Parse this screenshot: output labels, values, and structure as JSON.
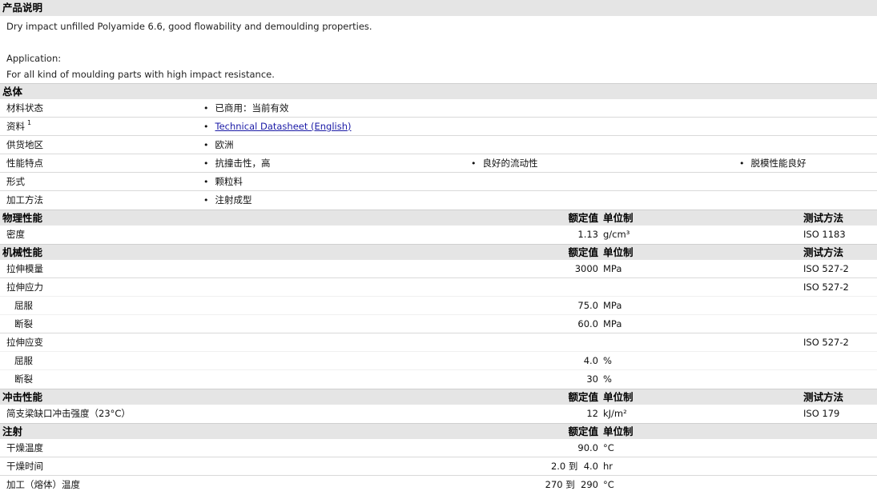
{
  "description": {
    "heading": "产品说明",
    "lines": [
      "Dry impact unfilled Polyamide 6.6, good flowability and demoulding properties.",
      "",
      "Application:",
      "For all kind of moulding parts with high impact resistance."
    ]
  },
  "general": {
    "heading": "总体",
    "rows": [
      {
        "label": "材料状态",
        "values": [
          "已商用：当前有效"
        ]
      },
      {
        "label": "资料",
        "sup": "1",
        "values": [
          "Technical Datasheet (English)"
        ]
      },
      {
        "label": "供货地区",
        "values": [
          "欧洲"
        ]
      },
      {
        "label": "性能特点",
        "values": [
          "抗撞击性，高",
          "良好的流动性",
          "脱模性能良好"
        ]
      },
      {
        "label": "形式",
        "values": [
          "颗粒料"
        ]
      },
      {
        "label": "加工方法",
        "values": [
          "注射成型"
        ]
      }
    ]
  },
  "col_headers": {
    "value": "额定值",
    "unit": "单位制",
    "method": "测试方法"
  },
  "physical": {
    "heading": "物理性能",
    "rows": [
      {
        "label": "密度",
        "value": "1.13",
        "unit": "g/cm³",
        "method": "ISO 1183"
      }
    ]
  },
  "mechanical": {
    "heading": "机械性能",
    "rows": [
      {
        "label": "拉伸模量",
        "value": "3000",
        "unit": "MPa",
        "method": "ISO 527-2"
      },
      {
        "label": "拉伸应力",
        "value": "",
        "unit": "",
        "method": "ISO 527-2"
      },
      {
        "label": "屈服",
        "value": "75.0",
        "unit": "MPa",
        "method": ""
      },
      {
        "label": "断裂",
        "value": "60.0",
        "unit": "MPa",
        "method": ""
      },
      {
        "label": "拉伸应变",
        "value": "",
        "unit": "",
        "method": "ISO 527-2"
      },
      {
        "label": "屈服",
        "value": "4.0",
        "unit": "%",
        "method": ""
      },
      {
        "label": "断裂",
        "value": "30",
        "unit": "%",
        "method": ""
      }
    ]
  },
  "impact": {
    "heading": "冲击性能",
    "rows": [
      {
        "label": "简支梁缺口冲击强度（23°C）",
        "value": "12",
        "unit": "kJ/m²",
        "method": "ISO 179"
      }
    ]
  },
  "injection": {
    "heading": "注射",
    "rows": [
      {
        "label": "干燥温度",
        "value": "90.0",
        "unit": "°C"
      },
      {
        "label": "干燥时间",
        "value": "2.0 到  4.0",
        "unit": "hr"
      },
      {
        "label": "加工（熔体）温度",
        "value": "270 到  290",
        "unit": "°C"
      }
    ]
  }
}
